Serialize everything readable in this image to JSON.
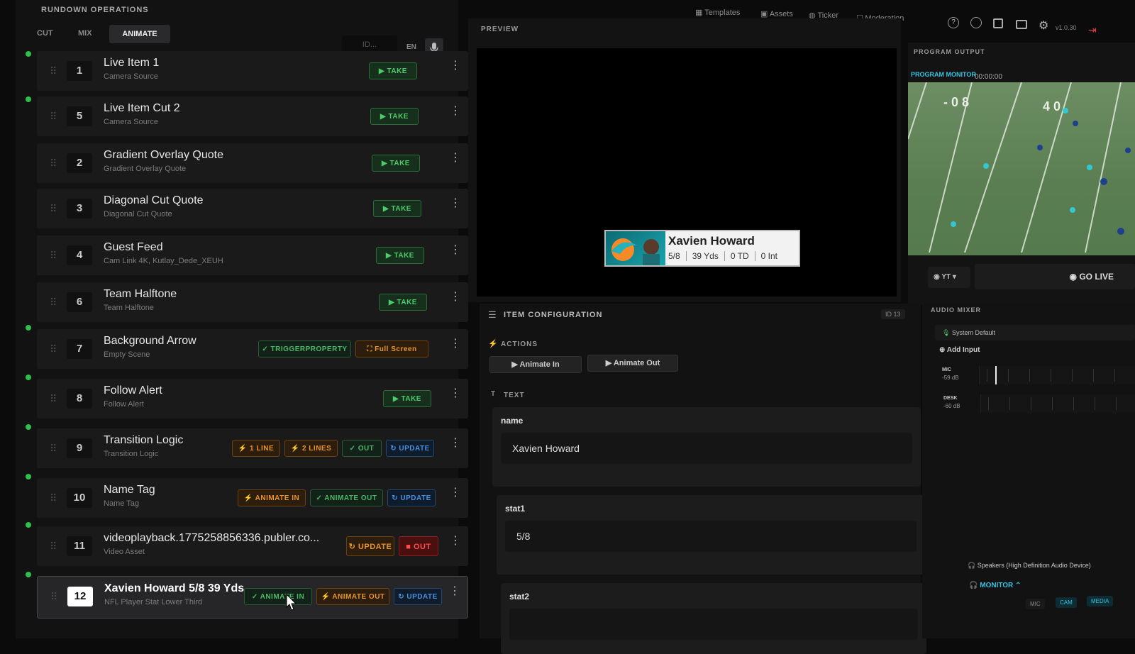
{
  "rundown": {
    "title": "RUNDOWN OPERATIONS",
    "tabs": [
      "CUT",
      "MIX",
      "ANIMATE"
    ],
    "active_tab": "ANIMATE",
    "id_placeholder": "ID...",
    "lang": "EN"
  },
  "items": [
    {
      "num": "1",
      "title": "Live Item 1",
      "sub": "Camera Source",
      "live": true,
      "actions": [
        {
          "label": "TAKE",
          "kind": "take"
        }
      ]
    },
    {
      "num": "5",
      "title": "Live Item Cut 2",
      "sub": "Camera Source",
      "live": true,
      "actions": [
        {
          "label": "TAKE",
          "kind": "take"
        }
      ]
    },
    {
      "num": "2",
      "title": "Gradient Overlay Quote",
      "sub": "Gradient Overlay Quote",
      "live": false,
      "actions": [
        {
          "label": "TAKE",
          "kind": "take"
        }
      ]
    },
    {
      "num": "3",
      "title": "Diagonal Cut Quote",
      "sub": "Diagonal Cut Quote",
      "live": false,
      "actions": [
        {
          "label": "TAKE",
          "kind": "take"
        }
      ]
    },
    {
      "num": "4",
      "title": "Guest Feed",
      "sub": "Cam Link 4K, Kutlay_Dede_XEUH",
      "live": false,
      "actions": [
        {
          "label": "TAKE",
          "kind": "take"
        }
      ]
    },
    {
      "num": "6",
      "title": "Team Halftone",
      "sub": "Team Halftone",
      "live": false,
      "actions": [
        {
          "label": "TAKE",
          "kind": "take"
        }
      ]
    },
    {
      "num": "7",
      "title": "Background Arrow",
      "sub": "Empty Scene",
      "live": true,
      "actions": [
        {
          "label": "✓ TRIGGERPROPERTY",
          "kind": "green"
        },
        {
          "label": "⛶ Full Screen",
          "kind": "orange"
        }
      ]
    },
    {
      "num": "8",
      "title": "Follow Alert",
      "sub": "Follow Alert",
      "live": true,
      "actions": [
        {
          "label": "TAKE",
          "kind": "take"
        }
      ]
    },
    {
      "num": "9",
      "title": "Transition Logic",
      "sub": "Transition Logic",
      "live": true,
      "actions": [
        {
          "label": "⚡ 1 LINE",
          "kind": "orange"
        },
        {
          "label": "⚡ 2 LINES",
          "kind": "orange"
        },
        {
          "label": "✓ OUT",
          "kind": "green"
        },
        {
          "label": "↻ UPDATE",
          "kind": "blue"
        }
      ]
    },
    {
      "num": "10",
      "title": "Name Tag",
      "sub": "Name Tag",
      "live": true,
      "actions": [
        {
          "label": "⚡ ANIMATE IN",
          "kind": "orange"
        },
        {
          "label": "✓ ANIMATE OUT",
          "kind": "green"
        },
        {
          "label": "↻ UPDATE",
          "kind": "blue"
        }
      ]
    },
    {
      "num": "11",
      "title": "videoplayback.1775258856336.publer.co...",
      "sub": "Video Asset",
      "live": true,
      "actions": [
        {
          "label": "↻ UPDATE",
          "kind": "orange"
        },
        {
          "label": "■ OUT",
          "kind": "red"
        }
      ]
    },
    {
      "num": "12",
      "title": "Xavien Howard 5/8 39 Yds ...",
      "sub": "NFL Player Stat Lower Third",
      "live": true,
      "selected": true,
      "actions": [
        {
          "label": "✓ ANIMATE IN",
          "kind": "green"
        },
        {
          "label": "⚡ ANIMATE OUT",
          "kind": "orange"
        },
        {
          "label": "↻ UPDATE",
          "kind": "blue"
        }
      ]
    }
  ],
  "topnav": {
    "templates": "Templates",
    "assets": "Assets",
    "ticker": "Ticker",
    "moderation": "Moderation",
    "version": "v1.0.30"
  },
  "preview": {
    "title": "PREVIEW",
    "lower_third": {
      "name": "Xavien Howard",
      "stats": [
        "5/8",
        "39 Yds",
        "0 TD",
        "0 Int"
      ]
    }
  },
  "config": {
    "title": "ITEM CONFIGURATION",
    "id": "ID 13",
    "actions_label": "ACTIONS",
    "animate_in": "Animate In",
    "animate_out": "Animate Out",
    "text_label": "TEXT",
    "fields": [
      {
        "label": "name",
        "value": "Xavien Howard"
      },
      {
        "label": "stat1",
        "value": "5/8"
      },
      {
        "label": "stat2",
        "value": ""
      }
    ]
  },
  "program": {
    "title": "PROGRAM OUTPUT",
    "monitor_label": "PROGRAM MONITOR",
    "timecode": "00:00:00",
    "platform": "YT",
    "go_live": "GO LIVE"
  },
  "audio": {
    "title": "AUDIO MIXER",
    "device": "System Default",
    "add_input": "Add Input",
    "channels": [
      {
        "name": "MIC",
        "level": "-59 dB"
      },
      {
        "name": "DESK",
        "level": "-60 dB"
      }
    ],
    "output": "Speakers (High Definition Audio Device)",
    "monitor": "MONITOR",
    "sources": [
      "MIC",
      "CAM",
      "MEDIA"
    ]
  },
  "colors": {
    "accent_green": "#2fbf4a",
    "take_green": "#4ecb6a",
    "orange": "#e9952a",
    "blue": "#4b8fe0",
    "red": "#ff4d4d",
    "golive": "#1c1c1d"
  }
}
